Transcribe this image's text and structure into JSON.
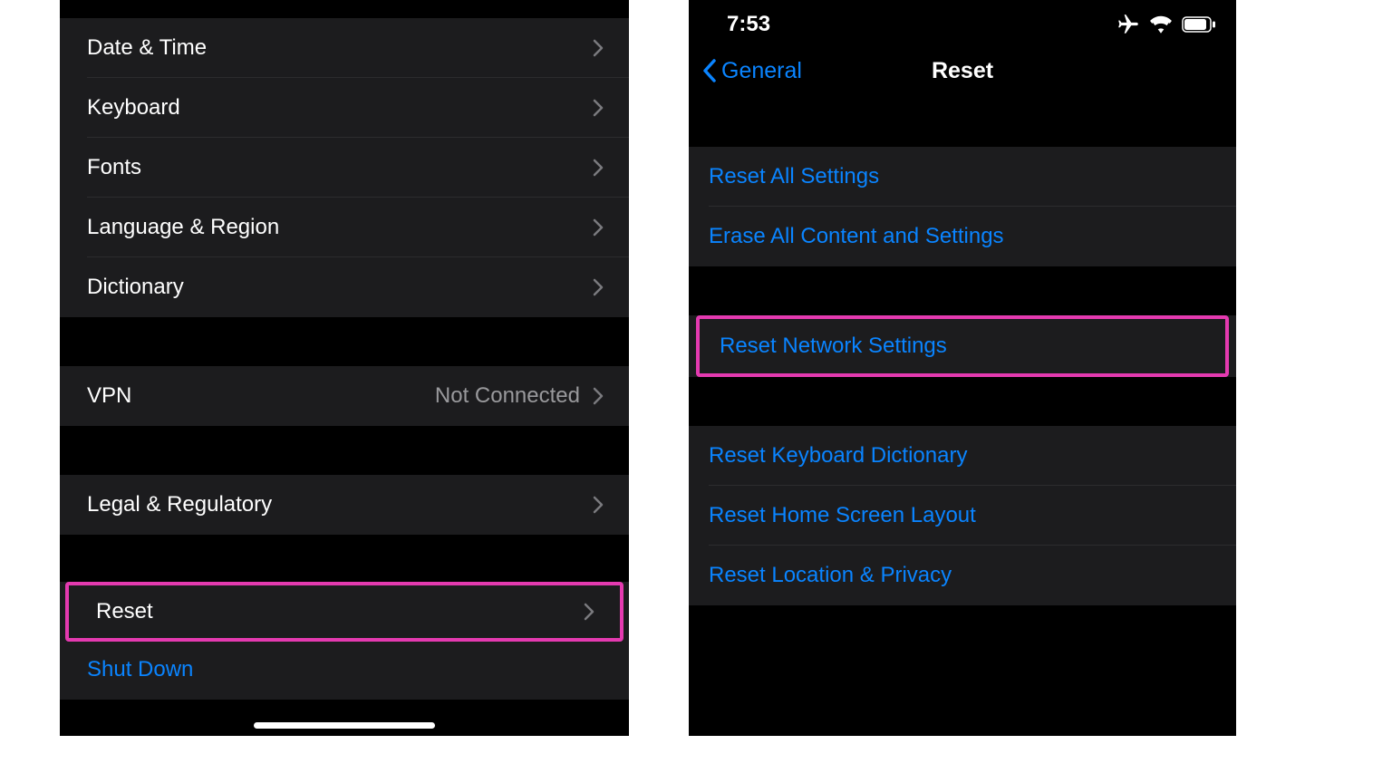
{
  "left": {
    "group1": [
      {
        "label": "Date & Time"
      },
      {
        "label": "Keyboard"
      },
      {
        "label": "Fonts"
      },
      {
        "label": "Language & Region"
      },
      {
        "label": "Dictionary"
      }
    ],
    "vpn": {
      "label": "VPN",
      "detail": "Not Connected"
    },
    "legal": {
      "label": "Legal & Regulatory"
    },
    "reset": {
      "label": "Reset"
    },
    "shutdown": {
      "label": "Shut Down"
    }
  },
  "right": {
    "status": {
      "time": "7:53"
    },
    "nav": {
      "back": "General",
      "title": "Reset"
    },
    "group1": [
      {
        "label": "Reset All Settings"
      },
      {
        "label": "Erase All Content and Settings"
      }
    ],
    "network": {
      "label": "Reset Network Settings"
    },
    "group3": [
      {
        "label": "Reset Keyboard Dictionary"
      },
      {
        "label": "Reset Home Screen Layout"
      },
      {
        "label": "Reset Location & Privacy"
      }
    ]
  },
  "colors": {
    "accent": "#0a84ff",
    "highlight": "#e43ab0"
  }
}
